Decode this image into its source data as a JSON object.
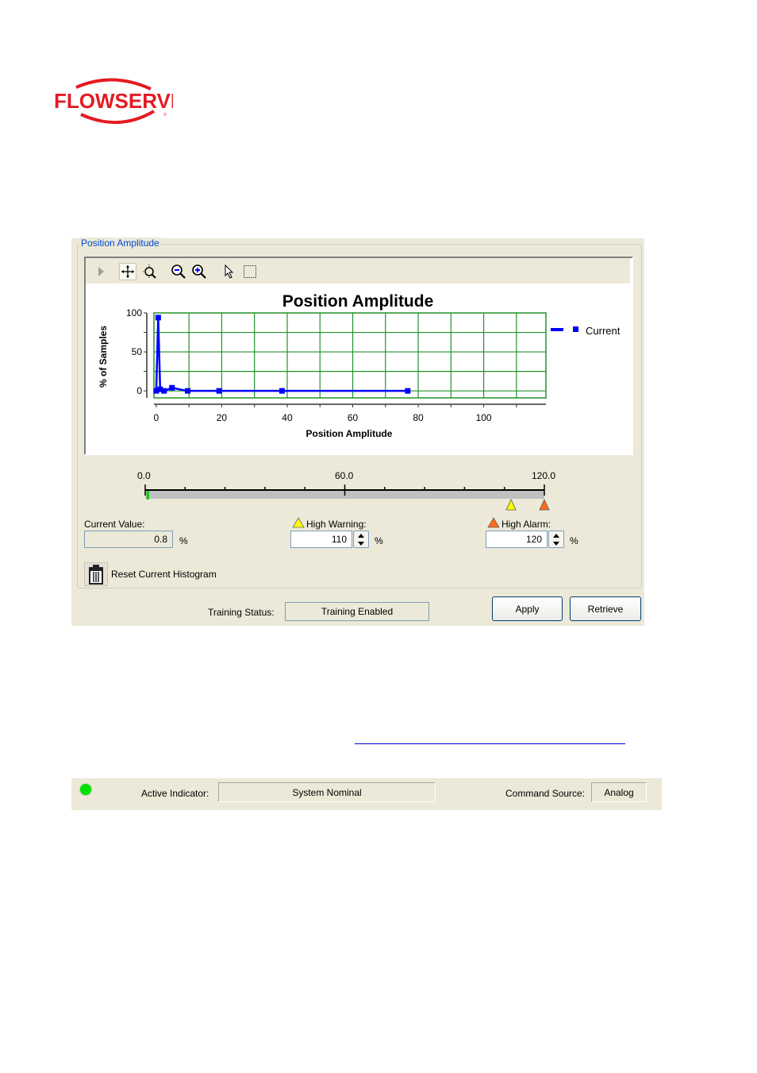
{
  "logo": {
    "text": "FLOWSERVE",
    "color": "#e31b23"
  },
  "panel": {
    "group_title": "Position Amplitude",
    "toolbar": {
      "icons": [
        "play-arrow-icon",
        "pan-icon",
        "zoom-box-icon",
        "zoom-out-icon",
        "zoom-in-icon",
        "select-pointer-icon",
        "select-rectangle-icon"
      ]
    },
    "chart": {
      "legend_label": "Current"
    },
    "slider": {
      "labels": [
        "0.0",
        "60.0",
        "120.0"
      ],
      "min": 0,
      "max": 120,
      "current_value": 0.8,
      "high_warning": 110,
      "high_alarm": 120,
      "colors": {
        "warning": "#ffff00",
        "alarm": "#ff6a1a",
        "current": "#00cc00",
        "track": "#c0c0c0"
      }
    },
    "current_value": {
      "label": "Current Value:",
      "value": "0.8",
      "unit": "%"
    },
    "high_warning": {
      "label": "High Warning:",
      "value": "110",
      "unit": "%"
    },
    "high_alarm": {
      "label": "High Alarm:",
      "value": "120",
      "unit": "%"
    },
    "reset_label": "Reset Current Histogram",
    "training_status": {
      "label": "Training Status:",
      "value": "Training Enabled"
    },
    "apply_label": "Apply",
    "retrieve_label": "Retrieve"
  },
  "status_bar": {
    "indicator_color": "#00e000",
    "active_indicator_label": "Active Indicator:",
    "active_indicator_value": "System Nominal",
    "command_source_label": "Command Source:",
    "command_source_value": "Analog"
  },
  "chart_data": {
    "type": "line",
    "title": "Position Amplitude",
    "xlabel": "Position Amplitude",
    "ylabel": "% of Samples",
    "xlim": [
      -0.7,
      119
    ],
    "ylim": [
      -9,
      100
    ],
    "x_ticks": [
      0,
      20,
      40,
      60,
      80,
      100
    ],
    "y_ticks": [
      0,
      50,
      100
    ],
    "x_grid": [
      10,
      20,
      30,
      40,
      50,
      60,
      70,
      80,
      90,
      100,
      110
    ],
    "y_grid": [
      0,
      25,
      50,
      75
    ],
    "grid": true,
    "legend_position": "right",
    "series": [
      {
        "name": "Current",
        "color": "#0000ff",
        "x": [
          0,
          0.6,
          1.2,
          2.4,
          4.8,
          9.6,
          19.2,
          38.4,
          76.8
        ],
        "y": [
          0,
          94,
          2,
          0,
          4,
          0,
          0,
          0,
          0
        ]
      }
    ]
  }
}
